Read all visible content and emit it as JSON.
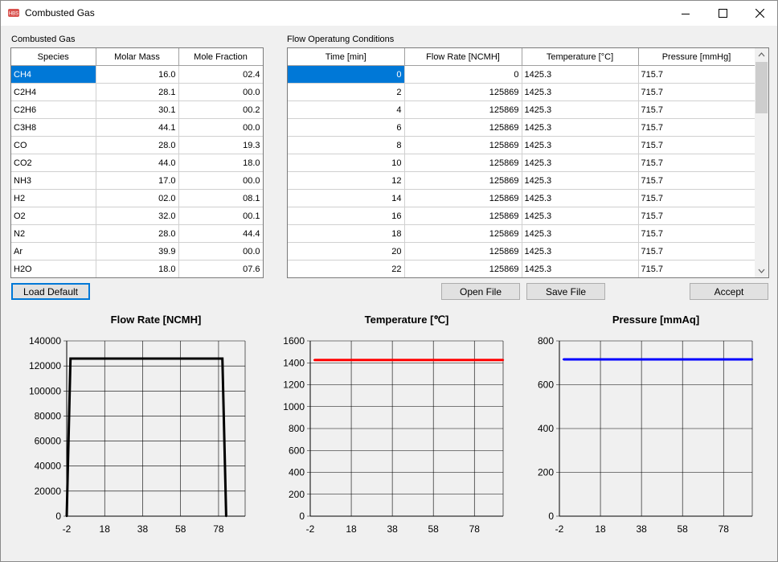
{
  "window": {
    "title": "Combusted Gas",
    "icon": "HBS",
    "controls": [
      "minimize-icon",
      "maximize-icon",
      "close-icon"
    ]
  },
  "gas_table": {
    "label": "Combusted Gas",
    "headers": [
      "Species",
      "Molar Mass",
      "Mole Fraction"
    ],
    "rows": [
      [
        "CH4",
        "16.0",
        "02.4"
      ],
      [
        "C2H4",
        "28.1",
        "00.0"
      ],
      [
        "C2H6",
        "30.1",
        "00.2"
      ],
      [
        "C3H8",
        "44.1",
        "00.0"
      ],
      [
        "CO",
        "28.0",
        "19.3"
      ],
      [
        "CO2",
        "44.0",
        "18.0"
      ],
      [
        "NH3",
        "17.0",
        "00.0"
      ],
      [
        "H2",
        "02.0",
        "08.1"
      ],
      [
        "O2",
        "32.0",
        "00.1"
      ],
      [
        "N2",
        "28.0",
        "44.4"
      ],
      [
        "Ar",
        "39.9",
        "00.0"
      ],
      [
        "H2O",
        "18.0",
        "07.6"
      ]
    ]
  },
  "flow_table": {
    "label": "Flow Operatung Conditions",
    "headers": [
      "Time [min]",
      "Flow Rate [NCMH]",
      "Temperature [°C]",
      "Pressure [mmHg]"
    ],
    "rows": [
      [
        "0",
        "0",
        "1425.3",
        "715.7"
      ],
      [
        "2",
        "125869",
        "1425.3",
        "715.7"
      ],
      [
        "4",
        "125869",
        "1425.3",
        "715.7"
      ],
      [
        "6",
        "125869",
        "1425.3",
        "715.7"
      ],
      [
        "8",
        "125869",
        "1425.3",
        "715.7"
      ],
      [
        "10",
        "125869",
        "1425.3",
        "715.7"
      ],
      [
        "12",
        "125869",
        "1425.3",
        "715.7"
      ],
      [
        "14",
        "125869",
        "1425.3",
        "715.7"
      ],
      [
        "16",
        "125869",
        "1425.3",
        "715.7"
      ],
      [
        "18",
        "125869",
        "1425.3",
        "715.7"
      ],
      [
        "20",
        "125869",
        "1425.3",
        "715.7"
      ],
      [
        "22",
        "125869",
        "1425.3",
        "715.7"
      ]
    ]
  },
  "buttons": {
    "load_default": "Load Default",
    "open_file": "Open File",
    "save_file": "Save File",
    "accept": "Accept"
  },
  "chart_data": [
    {
      "type": "line",
      "title": "Flow Rate [NCMH]",
      "color": "#000000",
      "x": [
        -2,
        0,
        80,
        82
      ],
      "y": [
        0,
        125869,
        125869,
        0
      ],
      "xlim": [
        -2,
        92
      ],
      "ylim": [
        0,
        140000
      ],
      "xticks": [
        -2,
        18,
        38,
        58,
        78
      ],
      "yticks": [
        0,
        20000,
        40000,
        60000,
        80000,
        100000,
        120000,
        140000
      ],
      "grid": true
    },
    {
      "type": "line",
      "title": "Temperature [℃]",
      "color": "#ff0000",
      "x": [
        0,
        2,
        80,
        92
      ],
      "y": [
        1425.3,
        1425.3,
        1425.3,
        1425.3
      ],
      "xlim": [
        -2,
        92
      ],
      "ylim": [
        0,
        1600
      ],
      "xticks": [
        -2,
        18,
        38,
        58,
        78
      ],
      "yticks": [
        0,
        200,
        400,
        600,
        800,
        1000,
        1200,
        1400,
        1600
      ],
      "grid": true
    },
    {
      "type": "line",
      "title": "Pressure [mmAq]",
      "color": "#0000ff",
      "x": [
        0,
        2,
        80,
        92
      ],
      "y": [
        715.7,
        715.7,
        715.7,
        715.7
      ],
      "xlim": [
        -2,
        92
      ],
      "ylim": [
        0,
        800
      ],
      "xticks": [
        -2,
        18,
        38,
        58,
        78
      ],
      "yticks": [
        0,
        200,
        400,
        600,
        800
      ],
      "grid": true
    }
  ]
}
